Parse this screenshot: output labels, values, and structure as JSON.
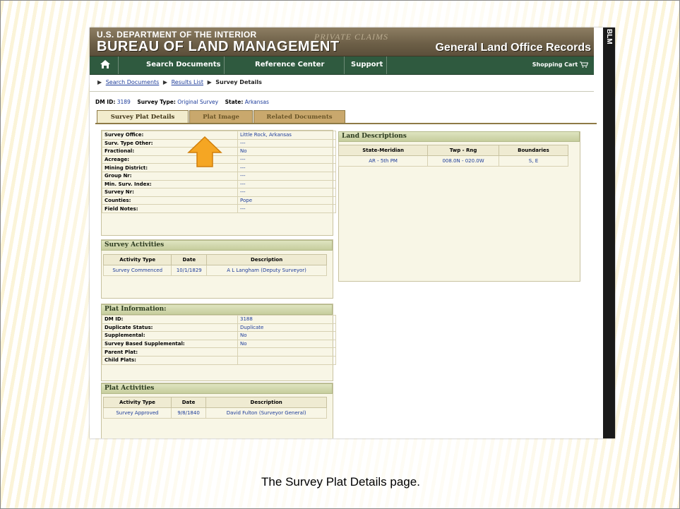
{
  "slide": {
    "caption": "The Survey Plat Details page."
  },
  "banner": {
    "department": "U.S. DEPARTMENT OF THE INTERIOR",
    "bureau": "BUREAU OF LAND MANAGEMENT",
    "watermark": "PRIVATE CLAIMS",
    "subtitle": "General Land Office Records",
    "side_tag": "BLM"
  },
  "nav": {
    "home_icon": "home-icon",
    "items": [
      "Search Documents",
      "Reference Center",
      "Support"
    ],
    "cart": "Shopping Cart"
  },
  "breadcrumb": {
    "items": [
      "Search Documents",
      "Results List",
      "Survey Details"
    ]
  },
  "meta": {
    "dm_id_label": "DM ID:",
    "dm_id": "3189",
    "survey_type_label": "Survey Type:",
    "survey_type": "Original Survey",
    "state_label": "State:",
    "state": "Arkansas"
  },
  "tabs": [
    "Survey Plat Details",
    "Plat Image",
    "Related Documents"
  ],
  "survey_details": [
    {
      "label": "Survey Office:",
      "value": "Little Rock, Arkansas"
    },
    {
      "label": "Surv. Type Other:",
      "value": "---"
    },
    {
      "label": "Fractional:",
      "value": "No"
    },
    {
      "label": "Acreage:",
      "value": "---"
    },
    {
      "label": "Mining District:",
      "value": "---"
    },
    {
      "label": "Group Nr:",
      "value": "---"
    },
    {
      "label": "Min. Surv. Index:",
      "value": "---"
    },
    {
      "label": "Survey Nr:",
      "value": "---"
    },
    {
      "label": "Counties:",
      "value": "Pope"
    },
    {
      "label": "Field Notes:",
      "value": "---"
    }
  ],
  "survey_activities": {
    "title": "Survey Activities",
    "headers": [
      "Activity Type",
      "Date",
      "Description"
    ],
    "rows": [
      [
        "Survey Commenced",
        "10/1/1829",
        "A L Langham (Deputy Surveyor)"
      ]
    ]
  },
  "plat_information": {
    "title": "Plat Information:",
    "rows": [
      {
        "label": "DM ID:",
        "value": "3188"
      },
      {
        "label": "Duplicate Status:",
        "value": "Duplicate"
      },
      {
        "label": "Supplemental:",
        "value": "No"
      },
      {
        "label": "Survey Based Supplemental:",
        "value": "No"
      },
      {
        "label": "Parent Plat:",
        "value": ""
      },
      {
        "label": "Child Plats:",
        "value": ""
      }
    ]
  },
  "plat_activities": {
    "title": "Plat Activities",
    "headers": [
      "Activity Type",
      "Date",
      "Description"
    ],
    "rows": [
      [
        "Survey Approved",
        "9/8/1840",
        "David Fulton (Surveyor General)"
      ]
    ]
  },
  "land_descriptions": {
    "title": "Land Descriptions",
    "headers": [
      "State-Meridian",
      "Twp - Rng",
      "Boundaries"
    ],
    "rows": [
      [
        "AR - 5th PM",
        "008.0N - 020.0W",
        "S, E"
      ]
    ]
  },
  "colors": {
    "banner": "#6e6048",
    "nav": "#2f5a3f",
    "link": "#1d3c9a",
    "tab_active": "#f2eccd",
    "tab_inactive": "#c9a86d",
    "arrow": "#f5a623"
  },
  "annotation": {
    "icon": "up-arrow-icon"
  }
}
